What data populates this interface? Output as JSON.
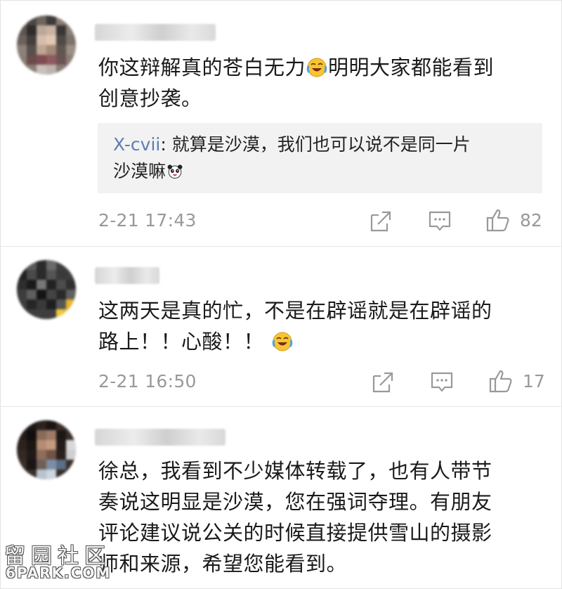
{
  "comments": [
    {
      "text_line1": "你这辩解真的苍白无力",
      "text_line1_after": "明明大家都能看到",
      "text_line2": "创意抄袭。",
      "reply_user": "X-cvii",
      "reply_sep": ": ",
      "reply_line1": "就算是沙漠，我们也可以说不是同一片",
      "reply_line2": "沙漠嘛",
      "time": "2-21 17:43",
      "likes": "82"
    },
    {
      "text_line1": "这两天是真的忙，不是在辟谣就是在辟谣的",
      "text_line2": "路上！！心酸！！",
      "time": "2-21 16:50",
      "likes": "17"
    },
    {
      "text_line1": "徐总，我看到不少媒体转载了，也有人带节",
      "text_line2": "奏说这明显是沙漠，您在强词夺理。有朋友",
      "text_line3": "评论建议说公关的时候直接提供雪山的摄影",
      "text_line4": "师和来源，希望您能看到。"
    }
  ],
  "watermark": {
    "cn": "留园社区",
    "en": "6PARK.COM"
  },
  "icons": {
    "share": "share-icon",
    "comment": "comment-icon",
    "like": "thumbs-up-icon",
    "emoji_cry_laugh": "laughing-crying-emoji-icon",
    "emoji_panda": "panda-emoji-icon"
  },
  "colors": {
    "reply_user": "#5b7fb0",
    "meta_text": "#999999",
    "reply_bg": "#f2f2f2"
  }
}
